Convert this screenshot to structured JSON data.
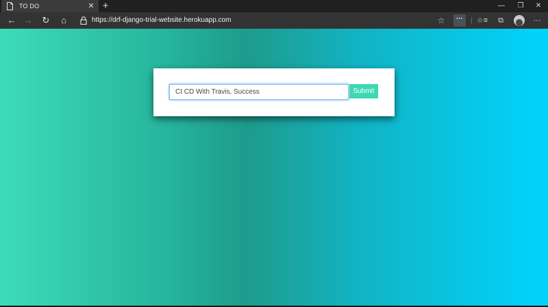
{
  "browser": {
    "tab": {
      "title": "TO DO",
      "close_glyph": "✕"
    },
    "new_tab_glyph": "+",
    "window_controls": {
      "minimize": "—",
      "restore": "❐",
      "close": "✕"
    },
    "nav": {
      "back": "←",
      "forward": "→",
      "refresh": "↻",
      "home": "⌂"
    },
    "address": {
      "url": "https://drf-django-trial-website.herokuapp.com",
      "star": "☆"
    },
    "toolbar": {
      "extension": "···",
      "favorites": "☆≡",
      "collections": "⧉",
      "menu": "···"
    },
    "icons": [
      "page-icon",
      "lock-icon",
      "star-icon",
      "extension-icon",
      "favorites-icon",
      "collections-icon",
      "profile-avatar",
      "more-menu-icon"
    ]
  },
  "page": {
    "form": {
      "input_value": "CI CD With Travis, Success",
      "submit_label": "Submit"
    },
    "colors": {
      "gradient_left": "#3ddbb9",
      "gradient_mid": "#1e9b8c",
      "gradient_right": "#00d4ff",
      "submit_bg": "#3ed8b3"
    }
  }
}
